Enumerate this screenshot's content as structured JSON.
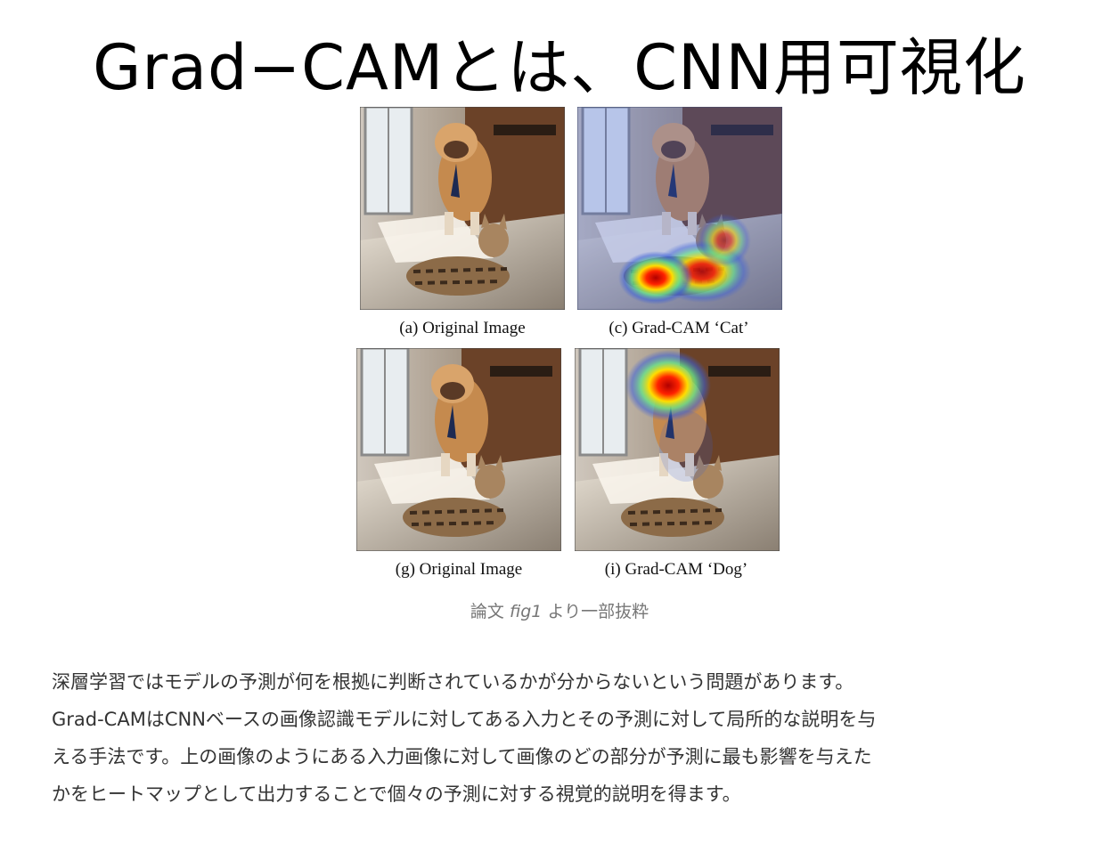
{
  "title": "Grad−CAMとは、CNN用可視化",
  "figure": {
    "panels": [
      {
        "caption": "(a) Original Image",
        "heatmap": "none"
      },
      {
        "caption": "(c) Grad-CAM ‘Cat’",
        "heatmap": "cat"
      },
      {
        "caption": "(g) Original Image",
        "heatmap": "none"
      },
      {
        "caption": "(i) Grad-CAM ‘Dog’",
        "heatmap": "dog"
      }
    ],
    "caption_prefix": "論文 ",
    "caption_em": "fig1",
    "caption_suffix": " より一部抜粋"
  },
  "body_lines": [
    "深層学習ではモデルの予測が何を根拠に判断されているかが分からないという問題があります。",
    "Grad-CAMはCNNベースの画像認識モデルに対してある入力とその予測に対して局所的な説明を与",
    "える手法です。上の画像のようにある入力画像に対して画像のどの部分が予測に最も影響を与えた",
    "かをヒートマップとして出力することで個々の予測に対する視覚的説明を得ます。"
  ]
}
